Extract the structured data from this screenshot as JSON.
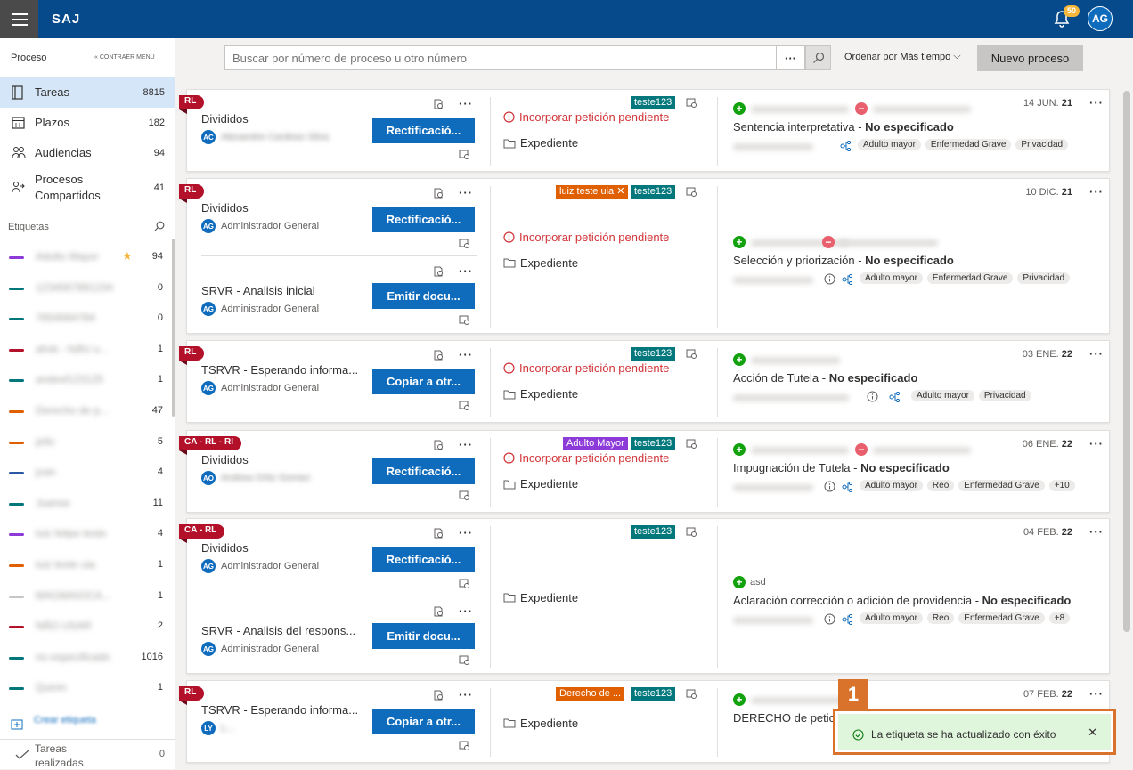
{
  "app": {
    "title": "SAJ",
    "notifications": "50",
    "user_initials": "AG"
  },
  "sidebar": {
    "section": "Proceso",
    "collapse": "CONTRAER MENÚ",
    "nav": [
      {
        "label": "Tareas",
        "count": "8815"
      },
      {
        "label": "Plazos",
        "count": "182"
      },
      {
        "label": "Audiencias",
        "count": "94"
      },
      {
        "label": "Procesos Compartidos",
        "count": "41"
      }
    ],
    "tags_title": "Etiquetas",
    "tags": [
      {
        "name": "Adulto Mayor",
        "count": "94",
        "color": "#8c3bd9"
      },
      {
        "name": "1234567891234",
        "count": "0",
        "color": "#03787c"
      },
      {
        "name": "7654564784",
        "count": "0",
        "color": "#03787c"
      },
      {
        "name": "ahsk - hdfci u...",
        "count": "1",
        "color": "#b3102a"
      },
      {
        "name": "andesf123125",
        "count": "1",
        "color": "#03787c"
      },
      {
        "name": "Derecho de p...",
        "count": "47",
        "color": "#e05f00"
      },
      {
        "name": "jello",
        "count": "5",
        "color": "#e05f00"
      },
      {
        "name": "juan",
        "count": "4",
        "color": "#2b57a4"
      },
      {
        "name": "Juanse",
        "count": "11",
        "color": "#03787c"
      },
      {
        "name": "luiz felipe teste",
        "count": "4",
        "color": "#8c3bd9"
      },
      {
        "name": "luiz teste uia",
        "count": "1",
        "color": "#e05f00"
      },
      {
        "name": "MAGMAIOCA...",
        "count": "1",
        "color": "#c8c6c4"
      },
      {
        "name": "NÃO USAR",
        "count": "2",
        "color": "#b3102a"
      },
      {
        "name": "no especificado",
        "count": "1016",
        "color": "#03787c"
      },
      {
        "name": "Quinin",
        "count": "1",
        "color": "#03787c"
      }
    ],
    "create_tag": "Crear etiqueta",
    "done_label": "Tareas realizadas",
    "done_count": "0"
  },
  "toolbar": {
    "search_placeholder": "Buscar por número de proceso u otro número",
    "order_prefix": "Ordenar por",
    "order_value": "Más tiempo",
    "new_button": "Nuevo proceso"
  },
  "cards": [
    {
      "ribbon": "RL",
      "date_day": "14 JUN.",
      "date_year": "21",
      "tasks": [
        {
          "title": "Divididos",
          "avatar": "AC",
          "who": "Alexandre Cardoso Silva",
          "button": "Rectificació..."
        }
      ],
      "pills": [
        {
          "text": "teste123",
          "color": "#03787c"
        }
      ],
      "warning": "Incorporar petición pendiente",
      "expediente": "Expediente",
      "party": "Sentencia interpretativa",
      "party_status": "No especificado",
      "chips": [
        "Adulto mayor",
        "Enfermedad Grave",
        "Privacidad"
      ]
    },
    {
      "ribbon": "RL",
      "date_day": "10 DIC.",
      "date_year": "21",
      "tasks": [
        {
          "title": "Divididos",
          "avatar": "AG",
          "who": "Administrador General",
          "button": "Rectificació..."
        },
        {
          "title": "SRVR - Analisis inicial",
          "avatar": "AG",
          "who": "Administrador General",
          "button": "Emitir docu..."
        }
      ],
      "pills": [
        {
          "text": "luiz teste uia",
          "color": "#e05f00"
        },
        {
          "text": "teste123",
          "color": "#03787c"
        }
      ],
      "warning": "Incorporar petición pendiente",
      "expediente": "Expediente",
      "party": "Selección y priorización",
      "party_status": "No especificado",
      "chips": [
        "Adulto mayor",
        "Enfermedad Grave",
        "Privacidad"
      ]
    },
    {
      "ribbon": "RL",
      "date_day": "03 ENE.",
      "date_year": "22",
      "tasks": [
        {
          "title": "TSRVR - Esperando informa...",
          "avatar": "AG",
          "who": "Administrador General",
          "button": "Copiar a otr..."
        }
      ],
      "pills": [
        {
          "text": "teste123",
          "color": "#03787c"
        }
      ],
      "warning": "Incorporar petición pendiente",
      "expediente": "Expediente",
      "party": "Acción de Tutela",
      "party_status": "No especificado",
      "chips": [
        "Adulto mayor",
        "Privacidad"
      ]
    },
    {
      "ribbon": "CA - RL - RI",
      "date_day": "06 ENE.",
      "date_year": "22",
      "tasks": [
        {
          "title": "Divididos",
          "avatar": "AO",
          "who": "Andrea Ortiz Gomez",
          "button": "Rectificació..."
        }
      ],
      "pills": [
        {
          "text": "Adulto Mayor",
          "color": "#8c3bd9"
        },
        {
          "text": "teste123",
          "color": "#03787c"
        }
      ],
      "warning": "Incorporar petición pendiente",
      "expediente": "Expediente",
      "party": "Impugnación de Tutela",
      "party_status": "No especificado",
      "chips": [
        "Adulto mayor",
        "Reo",
        "Enfermedad Grave",
        "+10"
      ]
    },
    {
      "ribbon": "CA - RL",
      "date_day": "04 FEB.",
      "date_year": "22",
      "tasks": [
        {
          "title": "Divididos",
          "avatar": "AG",
          "who": "Administrador General",
          "button": "Rectificació..."
        },
        {
          "title": "SRVR - Analisis del respons...",
          "avatar": "AG",
          "who": "Administrador General",
          "button": "Emitir docu..."
        }
      ],
      "pills": [
        {
          "text": "teste123",
          "color": "#03787c"
        }
      ],
      "warning": "",
      "expediente": "Expediente",
      "party_name": "asd",
      "party": "Aclaración corrección o adición de providencia",
      "party_status": "No especificado",
      "chips": [
        "Adulto mayor",
        "Reo",
        "Enfermedad Grave",
        "+8"
      ]
    },
    {
      "ribbon": "RL",
      "date_day": "07 FEB.",
      "date_year": "22",
      "tasks": [
        {
          "title": "TSRVR - Esperando informa...",
          "avatar": "LY",
          "who": "L...",
          "button": "Copiar a otr..."
        }
      ],
      "pills": [
        {
          "text": "Derecho de ...",
          "color": "#e05f00"
        },
        {
          "text": "teste123",
          "color": "#03787c"
        }
      ],
      "warning": "",
      "expediente": "Expediente",
      "party": "DERECHO de petició",
      "party_status": "",
      "chips": []
    }
  ],
  "toast": {
    "step": "1",
    "message": "La etiqueta se ha actualizado con éxito"
  }
}
